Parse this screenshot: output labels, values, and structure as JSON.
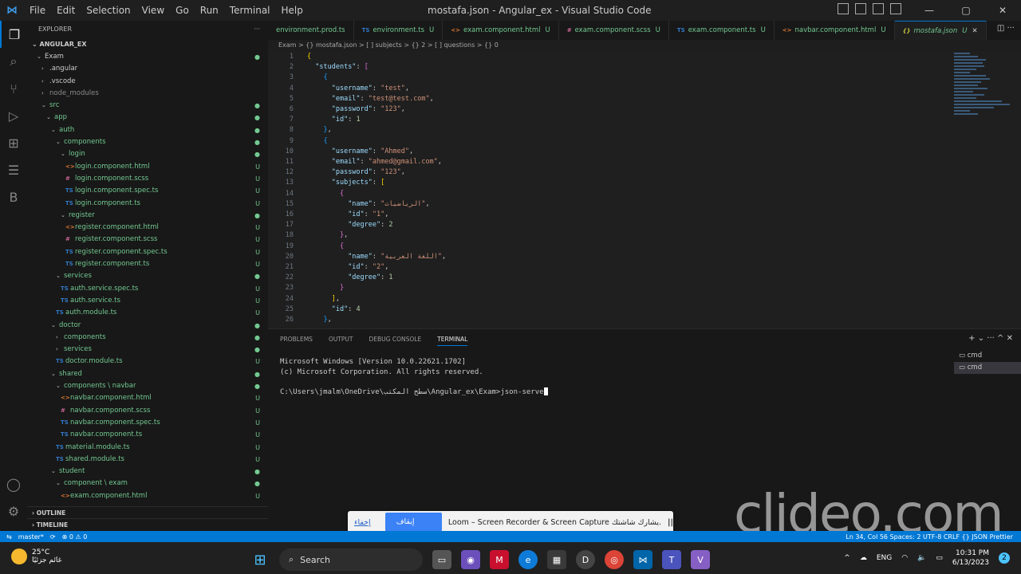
{
  "window": {
    "title": "mostafa.json - Angular_ex - Visual Studio Code",
    "menu": [
      "File",
      "Edit",
      "Selection",
      "View",
      "Go",
      "Run",
      "Terminal",
      "Help"
    ]
  },
  "sidebar": {
    "header": "EXPLORER",
    "project": "ANGULAR_EX",
    "tree": [
      {
        "label": "Exam",
        "level": 0,
        "type": "folder",
        "open": true,
        "status": "dot"
      },
      {
        "label": ".angular",
        "level": 1,
        "type": "folder",
        "open": false,
        "status": ""
      },
      {
        "label": ".vscode",
        "level": 1,
        "type": "folder",
        "open": false,
        "status": ""
      },
      {
        "label": "node_modules",
        "level": 1,
        "type": "folder",
        "open": false,
        "status": "",
        "muted": true
      },
      {
        "label": "src",
        "level": 1,
        "type": "folder",
        "open": true,
        "status": "dot"
      },
      {
        "label": "app",
        "level": 2,
        "type": "folder",
        "open": true,
        "status": "dot"
      },
      {
        "label": "auth",
        "level": 3,
        "type": "folder",
        "open": true,
        "status": "dot"
      },
      {
        "label": "components",
        "level": 4,
        "type": "folder",
        "open": true,
        "status": "dot"
      },
      {
        "label": "login",
        "level": 5,
        "type": "folder",
        "open": true,
        "status": "dot"
      },
      {
        "label": "login.component.html",
        "level": 6,
        "type": "html",
        "status": "U"
      },
      {
        "label": "login.component.scss",
        "level": 6,
        "type": "scss",
        "status": "U"
      },
      {
        "label": "login.component.spec.ts",
        "level": 6,
        "type": "ts",
        "status": "U"
      },
      {
        "label": "login.component.ts",
        "level": 6,
        "type": "ts",
        "status": "U"
      },
      {
        "label": "register",
        "level": 5,
        "type": "folder",
        "open": true,
        "status": "dot"
      },
      {
        "label": "register.component.html",
        "level": 6,
        "type": "html",
        "status": "U"
      },
      {
        "label": "register.component.scss",
        "level": 6,
        "type": "scss",
        "status": "U"
      },
      {
        "label": "register.component.spec.ts",
        "level": 6,
        "type": "ts",
        "status": "U"
      },
      {
        "label": "register.component.ts",
        "level": 6,
        "type": "ts",
        "status": "U"
      },
      {
        "label": "services",
        "level": 4,
        "type": "folder",
        "open": true,
        "status": "dot"
      },
      {
        "label": "auth.service.spec.ts",
        "level": 5,
        "type": "ts",
        "status": "U"
      },
      {
        "label": "auth.service.ts",
        "level": 5,
        "type": "ts",
        "status": "U"
      },
      {
        "label": "auth.module.ts",
        "level": 4,
        "type": "ts",
        "status": "U"
      },
      {
        "label": "doctor",
        "level": 3,
        "type": "folder",
        "open": true,
        "status": "dot"
      },
      {
        "label": "components",
        "level": 4,
        "type": "folder",
        "open": false,
        "status": "dot"
      },
      {
        "label": "services",
        "level": 4,
        "type": "folder",
        "open": false,
        "status": "dot"
      },
      {
        "label": "doctor.module.ts",
        "level": 4,
        "type": "ts",
        "status": "U"
      },
      {
        "label": "shared",
        "level": 3,
        "type": "folder",
        "open": true,
        "status": "dot"
      },
      {
        "label": "components \\ navbar",
        "level": 4,
        "type": "folder",
        "open": true,
        "status": "dot"
      },
      {
        "label": "navbar.component.html",
        "level": 5,
        "type": "html",
        "status": "U"
      },
      {
        "label": "navbar.component.scss",
        "level": 5,
        "type": "scss",
        "status": "U"
      },
      {
        "label": "navbar.component.spec.ts",
        "level": 5,
        "type": "ts",
        "status": "U"
      },
      {
        "label": "navbar.component.ts",
        "level": 5,
        "type": "ts",
        "status": "U"
      },
      {
        "label": "material.module.ts",
        "level": 4,
        "type": "ts",
        "status": "U"
      },
      {
        "label": "shared.module.ts",
        "level": 4,
        "type": "ts",
        "status": "U"
      },
      {
        "label": "student",
        "level": 3,
        "type": "folder",
        "open": true,
        "status": "dot"
      },
      {
        "label": "component \\ exam",
        "level": 4,
        "type": "folder",
        "open": true,
        "status": "dot"
      },
      {
        "label": "exam.component.html",
        "level": 5,
        "type": "html",
        "status": "U"
      }
    ],
    "outline": "OUTLINE",
    "timeline": "TIMELINE"
  },
  "tabs": [
    {
      "label": "environment.prod.ts",
      "icon": "",
      "status": "",
      "active": false
    },
    {
      "label": "environment.ts",
      "icon": "TS",
      "status": "U",
      "active": false
    },
    {
      "label": "exam.component.html",
      "icon": "<>",
      "status": "U",
      "active": false
    },
    {
      "label": "exam.component.scss",
      "icon": "#",
      "status": "U",
      "active": false
    },
    {
      "label": "exam.component.ts",
      "icon": "TS",
      "status": "U",
      "active": false
    },
    {
      "label": "navbar.component.html",
      "icon": "<>",
      "status": "U",
      "active": false
    },
    {
      "label": "mostafa.json",
      "icon": "{}",
      "status": "U",
      "active": true
    }
  ],
  "breadcrumb": "Exam > {} mostafa.json > [ ] subjects > {} 2 > [ ] questions > {} 0",
  "code_lines": [
    {
      "n": "1",
      "html": "<span class='p1'>{</span>"
    },
    {
      "n": "2",
      "html": "  <span class='k'>\"students\"</span>: <span class='p2'>[</span>"
    },
    {
      "n": "3",
      "html": "    <span class='p3'>{</span>"
    },
    {
      "n": "4",
      "html": "      <span class='k'>\"username\"</span>: <span class='s'>\"test\"</span>,"
    },
    {
      "n": "5",
      "html": "      <span class='k'>\"email\"</span>: <span class='s'>\"test@test.com\"</span>,"
    },
    {
      "n": "6",
      "html": "      <span class='k'>\"password\"</span>: <span class='s'>\"123\"</span>,"
    },
    {
      "n": "7",
      "html": "      <span class='k'>\"id\"</span>: <span class='n'>1</span>"
    },
    {
      "n": "8",
      "html": "    <span class='p3'>}</span>,"
    },
    {
      "n": "9",
      "html": "    <span class='p3'>{</span>"
    },
    {
      "n": "10",
      "html": "      <span class='k'>\"username\"</span>: <span class='s'>\"Ahmed\"</span>,"
    },
    {
      "n": "11",
      "html": "      <span class='k'>\"email\"</span>: <span class='s'>\"ahmed@gmail.com\"</span>,"
    },
    {
      "n": "12",
      "html": "      <span class='k'>\"password\"</span>: <span class='s'>\"123\"</span>,"
    },
    {
      "n": "13",
      "html": "      <span class='k'>\"subjects\"</span>: <span class='p1'>[</span>"
    },
    {
      "n": "14",
      "html": "        <span class='p2'>{</span>"
    },
    {
      "n": "15",
      "html": "          <span class='k'>\"name\"</span>: <span class='s'>\"الرياضيات\"</span>,"
    },
    {
      "n": "16",
      "html": "          <span class='k'>\"id\"</span>: <span class='s'>\"1\"</span>,"
    },
    {
      "n": "17",
      "html": "          <span class='k'>\"degree\"</span>: <span class='n'>2</span>"
    },
    {
      "n": "18",
      "html": "        <span class='p2'>}</span>,"
    },
    {
      "n": "19",
      "html": "        <span class='p2'>{</span>"
    },
    {
      "n": "20",
      "html": "          <span class='k'>\"name\"</span>: <span class='s'>\"اللغة العربية\"</span>,"
    },
    {
      "n": "21",
      "html": "          <span class='k'>\"id\"</span>: <span class='s'>\"2\"</span>,"
    },
    {
      "n": "22",
      "html": "          <span class='k'>\"degree\"</span>: <span class='n'>1</span>"
    },
    {
      "n": "23",
      "html": "        <span class='p2'>}</span>"
    },
    {
      "n": "24",
      "html": "      <span class='p1'>]</span>,"
    },
    {
      "n": "25",
      "html": "      <span class='k'>\"id\"</span>: <span class='n'>4</span>"
    },
    {
      "n": "26",
      "html": "    <span class='p3'>}</span>,"
    }
  ],
  "panel": {
    "tabs": [
      "PROBLEMS",
      "OUTPUT",
      "DEBUG CONSOLE",
      "TERMINAL"
    ],
    "active_tab": "TERMINAL",
    "terminal_lines": [
      "Microsoft Windows [Version 10.0.22621.1702]",
      "(c) Microsoft Corporation. All rights reserved.",
      "",
      "C:\\Users\\jmalm\\OneDrive\\سطح المكتب\\Angular_ex\\Exam>json-serve"
    ],
    "terminals": [
      "cmd",
      "cmd"
    ]
  },
  "loom": {
    "hide": "إخفاء",
    "stop": "إيقاف المشاركة",
    "message": "Loom – Screen Recorder & Screen Capture يشارك شاشتك.",
    "pause": "||"
  },
  "watermark": "clideo.com",
  "statusbar": {
    "branch": "master*",
    "sync": "⟳",
    "problems": "⊗ 0 ⚠ 0",
    "right": "Ln 34, Col 56   Spaces: 2   UTF-8   CRLF   {} JSON   Prettier"
  },
  "taskbar": {
    "weather_temp": "25°C",
    "weather_desc": "غائم جزئيًا",
    "search": "Search",
    "lang": "ENG",
    "time": "10:31 PM",
    "date": "6/13/2023",
    "notifications": "2"
  },
  "colors": {
    "accent": "#0078d4",
    "untracked": "#73c991",
    "editor_bg": "#1f1f1f",
    "sidebar_bg": "#181818"
  }
}
